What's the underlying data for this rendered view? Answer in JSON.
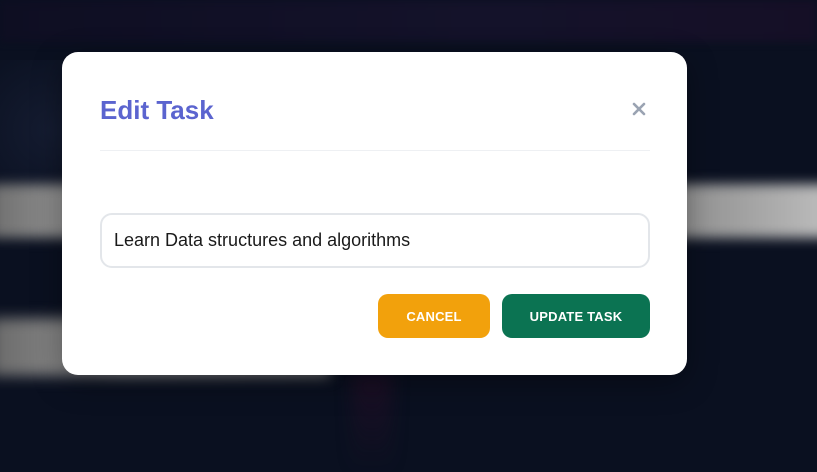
{
  "modal": {
    "title": "Edit Task",
    "close_icon": "close-icon",
    "input": {
      "value": "Learn Data structures and algorithms",
      "placeholder": ""
    },
    "cancel_label": "CANCEL",
    "update_label": "UPDATE TASK"
  },
  "colors": {
    "title": "#5b64cf",
    "close_icon": "#9aa3b2",
    "cancel_button": "#f2a10c",
    "update_button": "#0b7352",
    "backdrop": "#0a1020"
  }
}
